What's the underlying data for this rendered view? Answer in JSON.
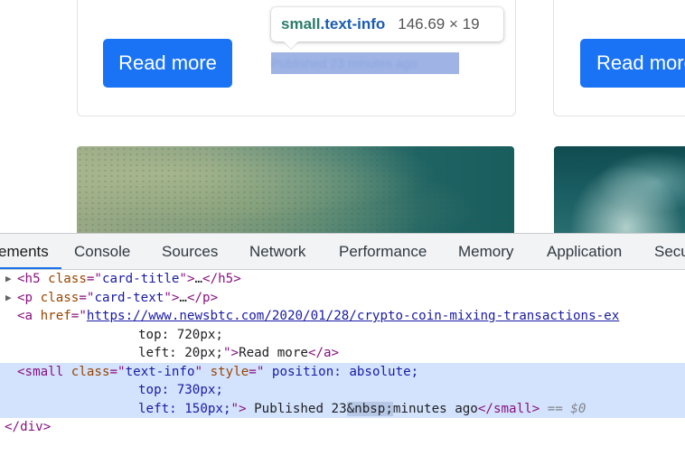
{
  "page": {
    "button_left_label": "Read more",
    "button_right_label": "Read more",
    "highlighted_text": "Published 23 minutes ago"
  },
  "tooltip": {
    "tag": "small",
    "class_name": ".text-info",
    "size": "146.69 × 19"
  },
  "devtools": {
    "tabs": [
      {
        "label": "Elements",
        "visible": "ements",
        "active": true
      },
      {
        "label": "Console"
      },
      {
        "label": "Sources"
      },
      {
        "label": "Network"
      },
      {
        "label": "Performance"
      },
      {
        "label": "Memory"
      },
      {
        "label": "Application"
      },
      {
        "label": "Secu"
      }
    ],
    "code": {
      "l1": {
        "open": "<h5 ",
        "attr": "class",
        "eq": "=\"",
        "val": "card-title",
        "close": "\">",
        "ell": "…",
        "end": "</h5>"
      },
      "l2": {
        "open": "<p ",
        "attr": "class",
        "eq": "=\"",
        "val": "card-text",
        "close": "\">",
        "ell": "…",
        "end": "</p>"
      },
      "l3": {
        "open": "<a ",
        "attr": "href",
        "eq": "=\"",
        "url": "https://www.newsbtc.com/2020/01/28/crypto-coin-mixing-transactions-ex"
      },
      "l4": {
        "text": "top: 720px;"
      },
      "l5": {
        "text": "left: 20px;",
        "close": "\">",
        "content": "Read more",
        "end": "</a>"
      },
      "l6": {
        "open": "<small ",
        "attr": "class",
        "eq": "=\"",
        "val": "text-info",
        "close": "\" ",
        "attr2": "style",
        "eq2": "=\"",
        "style": " position: absolute;"
      },
      "l7": {
        "text": "top: 730px;"
      },
      "l8": {
        "text": "left: 150px;",
        "close": "\">",
        "content1": " Published 23",
        "entity": "&nbsp;",
        "content2": "minutes ago",
        "end": "</small>",
        "marker": " == $0"
      },
      "l9": {
        "end": "</div>"
      }
    }
  },
  "colors": {
    "button": "#1a73f5",
    "selection": "#d3e3fd",
    "tag": "#881280",
    "attr": "#994500",
    "value": "#1a1aa6"
  }
}
